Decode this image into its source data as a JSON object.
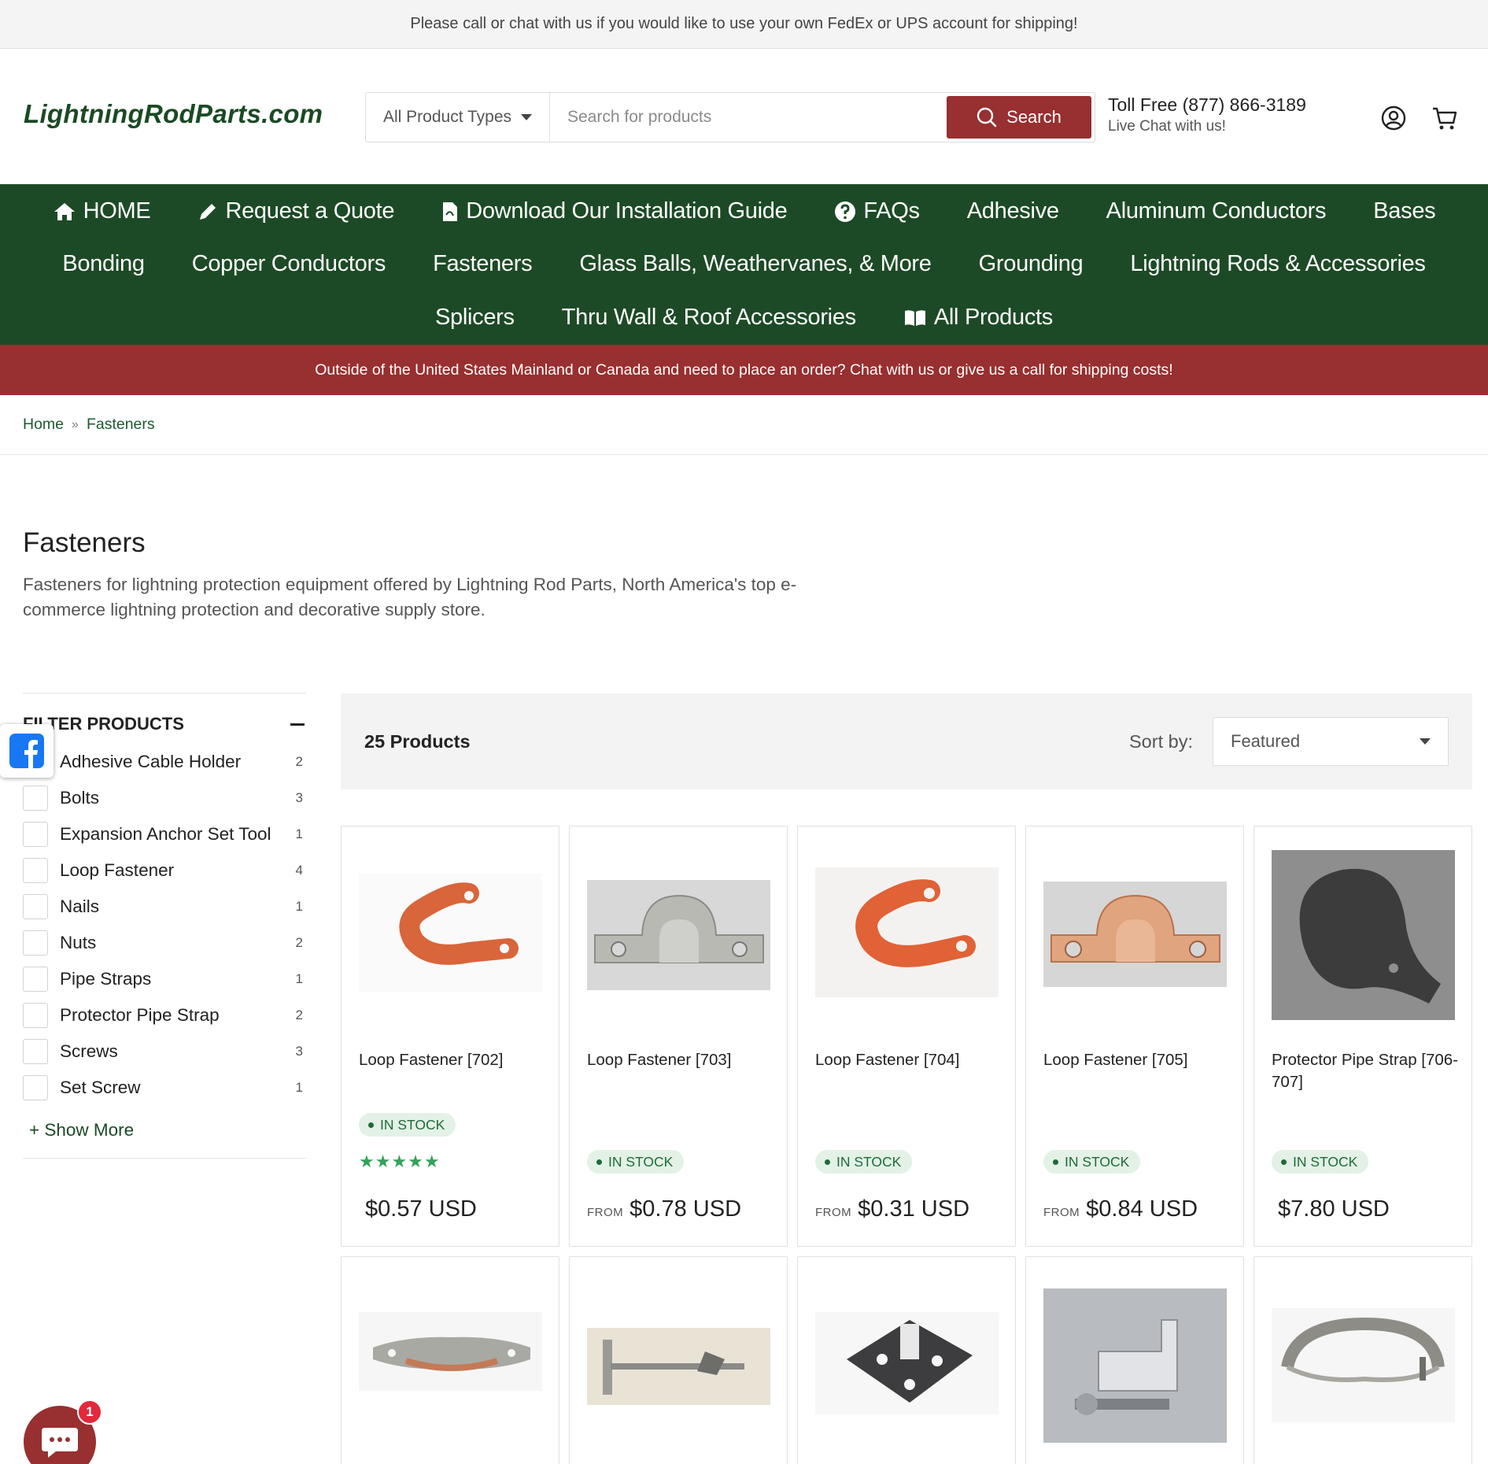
{
  "announcement": "Please call or chat with us if you would like to use your own FedEx or UPS account for shipping!",
  "header": {
    "logo": "LightningRodParts.com",
    "product_type": "All Product Types",
    "search_placeholder": "Search for products",
    "search_button": "Search",
    "toll_free": "Toll Free (877) 866-3189",
    "live_chat": "Live Chat with us!",
    "account_icon": "account-icon",
    "cart_icon": "cart-icon"
  },
  "nav": {
    "row1": [
      "HOME",
      "Request a Quote",
      "Download Our Installation Guide",
      "FAQs",
      "Adhesive",
      "Aluminum Conductors",
      "Bases"
    ],
    "row2": [
      "Bonding",
      "Copper Conductors",
      "Fasteners",
      "Glass Balls, Weathervanes, & More",
      "Grounding",
      "Lightning Rods & Accessories"
    ],
    "row3": [
      "Splicers",
      "Thru Wall & Roof Accessories",
      "All Products"
    ]
  },
  "notice": "Outside of the United States Mainland or Canada and need to place an order? Chat with us or give us a call for shipping costs!",
  "breadcrumb": {
    "home": "Home",
    "sep": "»",
    "current": "Fasteners"
  },
  "page": {
    "title": "Fasteners",
    "description": "Fasteners for lightning protection equipment offered by Lightning Rod Parts, North America's top e-commerce lightning protection and decorative supply store."
  },
  "filter": {
    "title": "FILTER PRODUCTS",
    "items": [
      {
        "label": "Adhesive Cable Holder",
        "count": "2"
      },
      {
        "label": "Bolts",
        "count": "3"
      },
      {
        "label": "Expansion Anchor Set Tool",
        "count": "1"
      },
      {
        "label": "Loop Fastener",
        "count": "4"
      },
      {
        "label": "Nails",
        "count": "1"
      },
      {
        "label": "Nuts",
        "count": "2"
      },
      {
        "label": "Pipe Straps",
        "count": "1"
      },
      {
        "label": "Protector Pipe Strap",
        "count": "2"
      },
      {
        "label": "Screws",
        "count": "3"
      },
      {
        "label": "Set Screw",
        "count": "1"
      }
    ],
    "show_more": "+ Show More"
  },
  "toolbar": {
    "count": "25 Products",
    "sort_label": "Sort by:",
    "sort_value": "Featured"
  },
  "products": [
    {
      "name": "Loop Fastener [702]",
      "stock": "IN STOCK",
      "from": "",
      "price": "$0.57 USD",
      "rating": "★★★★★"
    },
    {
      "name": "Loop Fastener [703]",
      "stock": "IN STOCK",
      "from": "FROM",
      "price": "$0.78 USD",
      "rating": ""
    },
    {
      "name": "Loop Fastener [704]",
      "stock": "IN STOCK",
      "from": "FROM",
      "price": "$0.31 USD",
      "rating": ""
    },
    {
      "name": "Loop Fastener [705]",
      "stock": "IN STOCK",
      "from": "FROM",
      "price": "$0.84 USD",
      "rating": ""
    },
    {
      "name": "Protector Pipe Strap [706-707]",
      "stock": "IN STOCK",
      "from": "",
      "price": "$7.80 USD",
      "rating": ""
    }
  ],
  "chat": {
    "badge": "1"
  },
  "colors": {
    "brand_green": "#1d4a26",
    "brand_red": "#982f30",
    "stock_green": "#1d6b37"
  }
}
